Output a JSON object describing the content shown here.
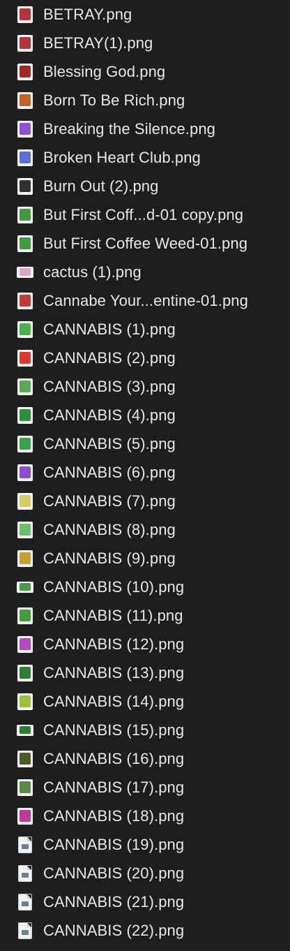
{
  "files": [
    {
      "name": "BETRAY.png",
      "icon": "red-figure-thumbnail-icon",
      "color": "#b4343a"
    },
    {
      "name": "BETRAY(1).png",
      "icon": "red-figure-thumbnail-icon",
      "color": "#b4343a"
    },
    {
      "name": "Blessing God.png",
      "icon": "red-figure-thumbnail-icon",
      "color": "#a02a2a"
    },
    {
      "name": "Born To Be Rich.png",
      "icon": "orange-figure-thumbnail-icon",
      "color": "#c4602c"
    },
    {
      "name": "Breaking the Silence.png",
      "icon": "purple-art-thumbnail-icon",
      "color": "#8e4fd0"
    },
    {
      "name": "Broken Heart Club.png",
      "icon": "blue-pattern-thumbnail-icon",
      "color": "#5a6fd8"
    },
    {
      "name": "Burn Out (2).png",
      "icon": "black-car-thumbnail-icon",
      "color": "#303030"
    },
    {
      "name": "But First Coff...d-01 copy.png",
      "icon": "green-leaf-thumbnail-icon",
      "color": "#3e9a3e"
    },
    {
      "name": "But First Coffee Weed-01.png",
      "icon": "green-leaf-thumbnail-icon",
      "color": "#3e9a3e"
    },
    {
      "name": "cactus (1).png",
      "icon": "pink-outline-thumbnail-icon",
      "color": "#d9a7c7"
    },
    {
      "name": "Cannabe Your...entine-01.png",
      "icon": "red-text-thumbnail-icon",
      "color": "#c23a3a"
    },
    {
      "name": "CANNABIS (1).png",
      "icon": "rainbow-leaf-thumbnail-icon",
      "color": "#4caf50"
    },
    {
      "name": "CANNABIS (2).png",
      "icon": "rasta-circle-thumbnail-icon",
      "color": "#d83a2a"
    },
    {
      "name": "CANNABIS (3).png",
      "icon": "green-leaf-thumbnail-icon",
      "color": "#5aa85a"
    },
    {
      "name": "CANNABIS (4).png",
      "icon": "green-leaf-thumbnail-icon",
      "color": "#2f8f3a"
    },
    {
      "name": "CANNABIS (5).png",
      "icon": "green-leaf-thumbnail-icon",
      "color": "#3aa04a"
    },
    {
      "name": "CANNABIS (6).png",
      "icon": "rainbow-leaf-thumbnail-icon",
      "color": "#8a4fd0"
    },
    {
      "name": "CANNABIS (7).png",
      "icon": "yellow-leaf-thumbnail-icon",
      "color": "#d8c86a"
    },
    {
      "name": "CANNABIS (8).png",
      "icon": "green-leaf-thumbnail-icon",
      "color": "#6abf6a"
    },
    {
      "name": "CANNABIS (9).png",
      "icon": "420-text-thumbnail-icon",
      "color": "#c8a030"
    },
    {
      "name": "CANNABIS (10).png",
      "icon": "green-banner-thumbnail-icon",
      "color": "#4a9a4a"
    },
    {
      "name": "CANNABIS (11).png",
      "icon": "green-leaf-thumbnail-icon",
      "color": "#3f9f3f"
    },
    {
      "name": "CANNABIS (12).png",
      "icon": "purple-leaf-thumbnail-icon",
      "color": "#b04ac0"
    },
    {
      "name": "CANNABIS (13).png",
      "icon": "green-wreath-thumbnail-icon",
      "color": "#2e7d32"
    },
    {
      "name": "CANNABIS (14).png",
      "icon": "yellow-leaf-thumbnail-icon",
      "color": "#9bbf3a"
    },
    {
      "name": "CANNABIS (15).png",
      "icon": "420-text-thumbnail-icon",
      "color": "#2e7d32"
    },
    {
      "name": "CANNABIS (16).png",
      "icon": "dark-leaf-thumbnail-icon",
      "color": "#4a5a2a"
    },
    {
      "name": "CANNABIS (17).png",
      "icon": "green-skull-thumbnail-icon",
      "color": "#5a8a4a"
    },
    {
      "name": "CANNABIS (18).png",
      "icon": "colorful-skull-thumbnail-icon",
      "color": "#c0389a"
    },
    {
      "name": "CANNABIS (19).png",
      "icon": "generic-image-file-icon",
      "color": "#6a7f9a"
    },
    {
      "name": "CANNABIS (20).png",
      "icon": "generic-image-file-icon",
      "color": "#6a7f9a"
    },
    {
      "name": "CANNABIS (21).png",
      "icon": "generic-image-file-icon",
      "color": "#6a7f9a"
    },
    {
      "name": "CANNABIS (22).png",
      "icon": "generic-image-file-icon",
      "color": "#6a7f9a"
    }
  ]
}
